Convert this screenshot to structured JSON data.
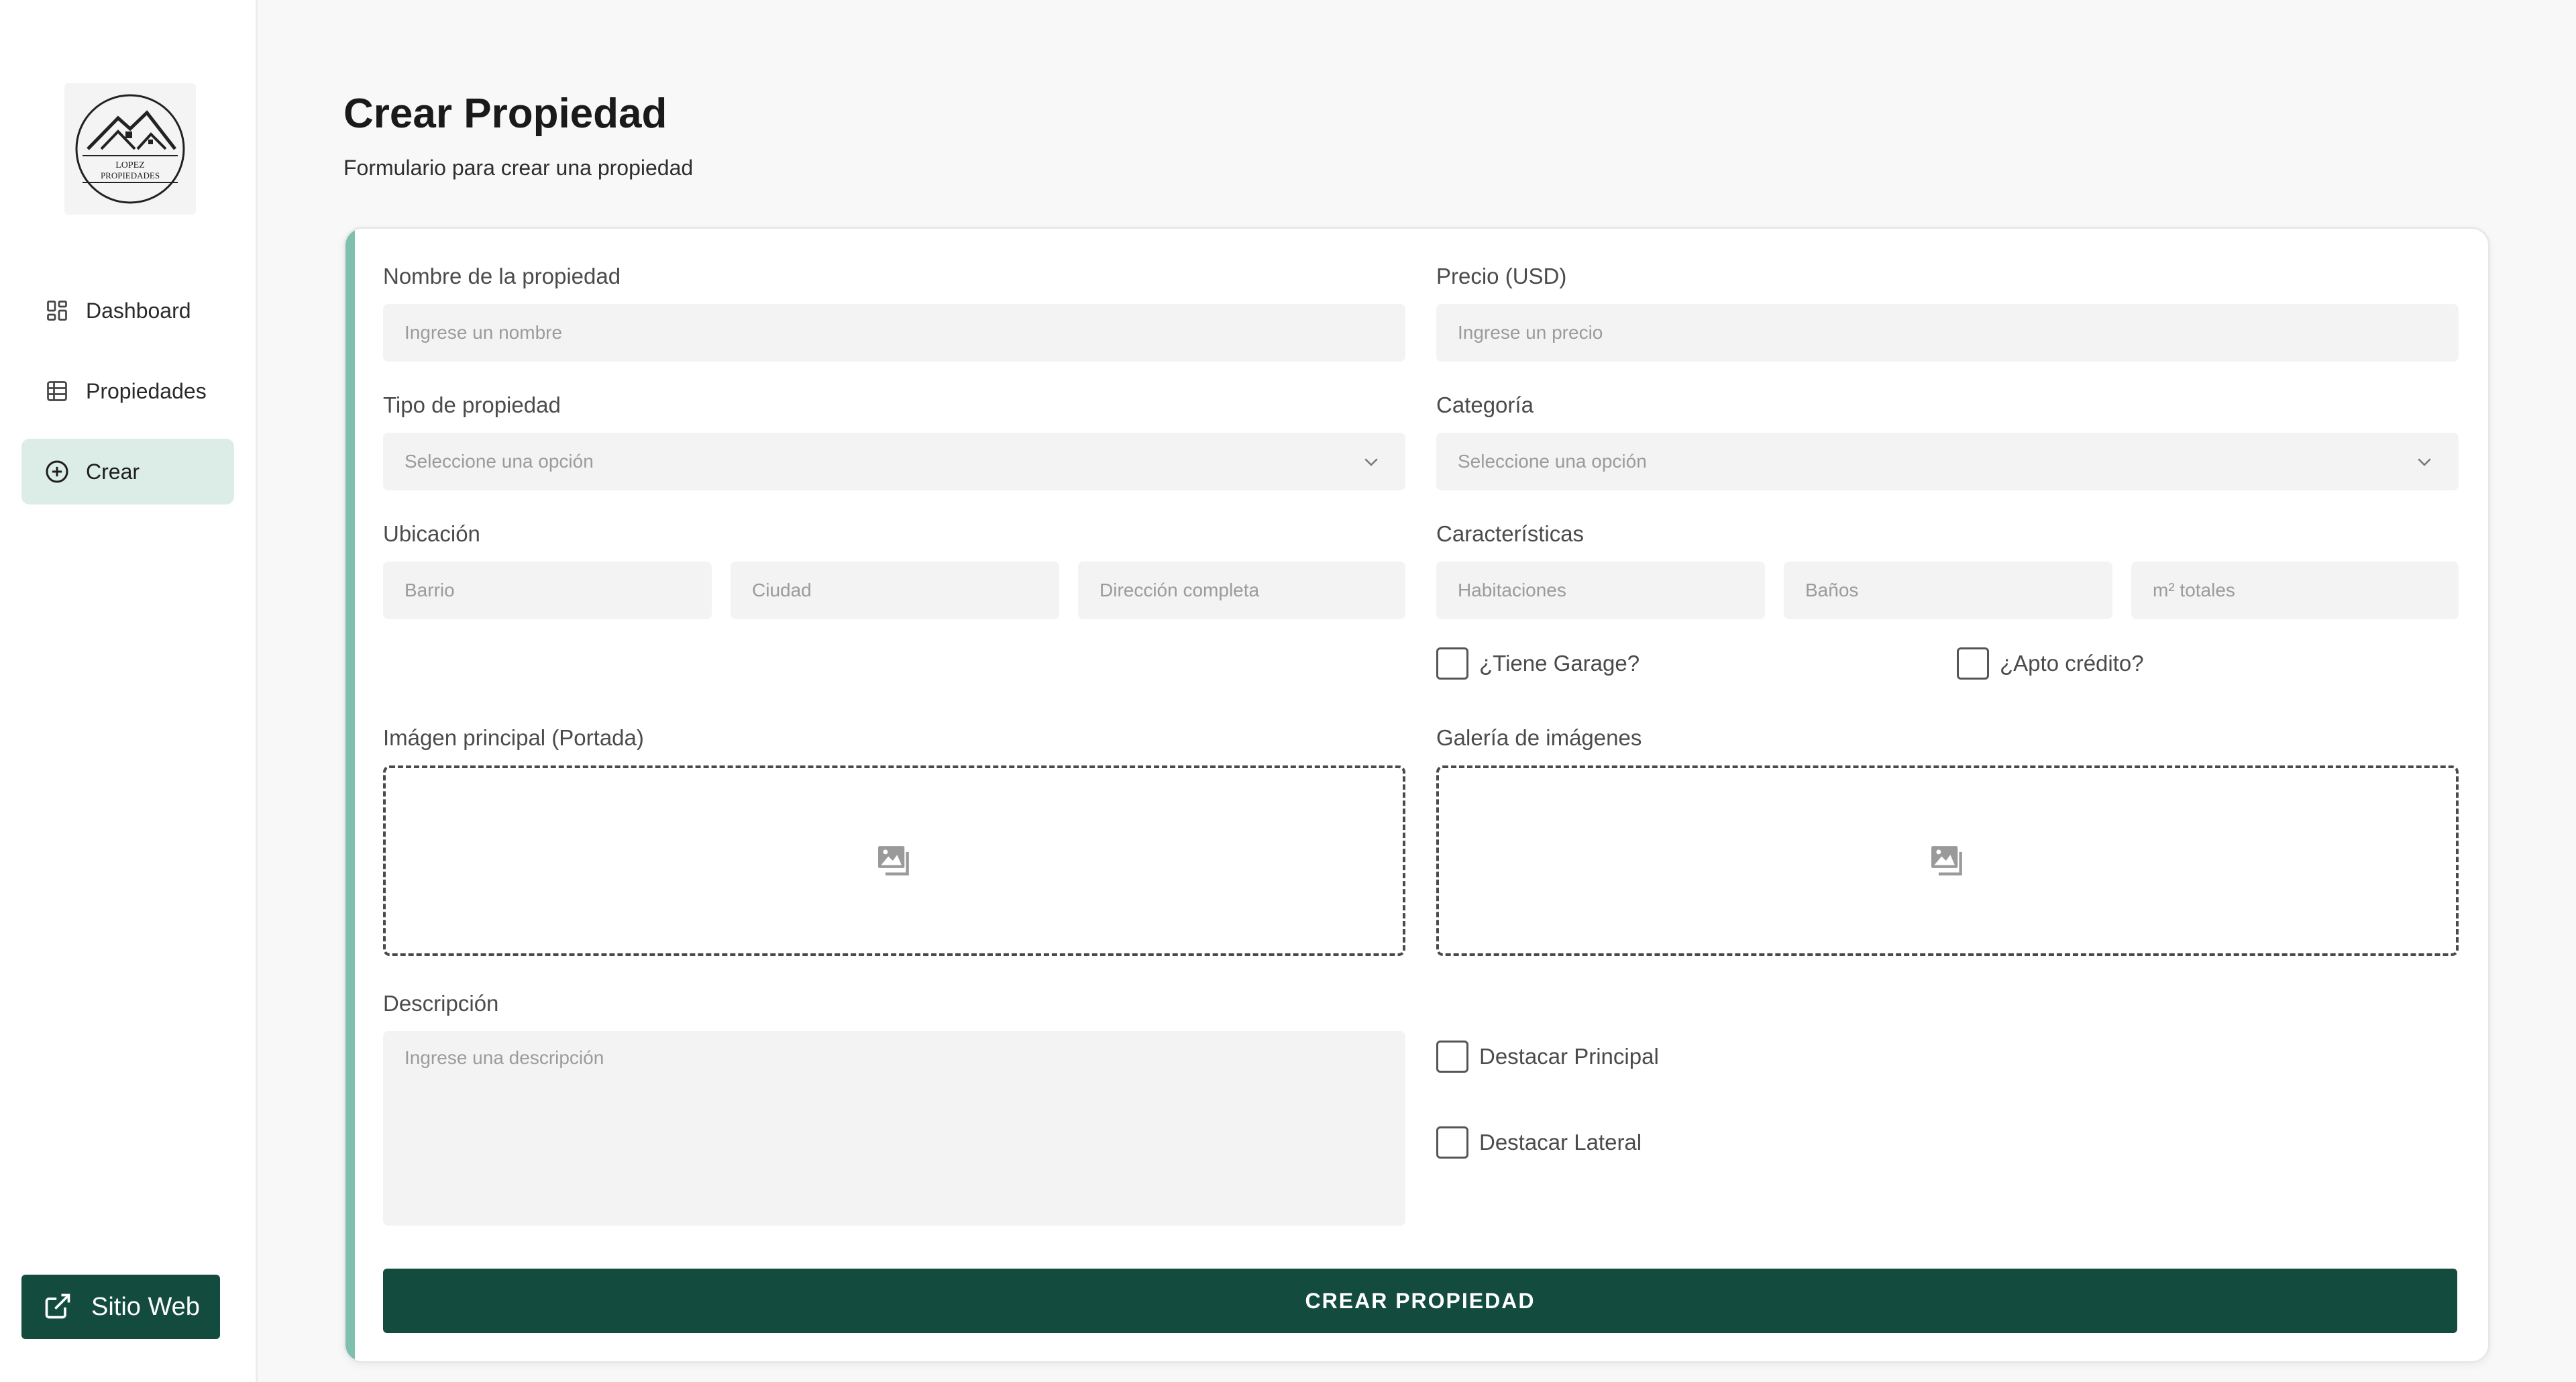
{
  "sidebar": {
    "logo_text_line1": "LOPEZ",
    "logo_text_line2": "PROPIEDADES",
    "items": [
      {
        "label": "Dashboard",
        "icon": "dashboard-grid-icon"
      },
      {
        "label": "Propiedades",
        "icon": "table-icon"
      },
      {
        "label": "Crear",
        "icon": "plus-circle-icon",
        "active": true
      }
    ],
    "website_button": "Sitio Web"
  },
  "header": {
    "title": "Crear Propiedad",
    "subtitle": "Formulario para crear una propiedad"
  },
  "form": {
    "name": {
      "label": "Nombre de la propiedad",
      "placeholder": "Ingrese un nombre"
    },
    "price": {
      "label": "Precio (USD)",
      "placeholder": "Ingrese un precio"
    },
    "type": {
      "label": "Tipo de propiedad",
      "placeholder": "Seleccione una opción"
    },
    "category": {
      "label": "Categoría",
      "placeholder": "Seleccione una opción"
    },
    "location": {
      "label": "Ubicación",
      "neighborhood": "Barrio",
      "city": "Ciudad",
      "address": "Dirección completa"
    },
    "features": {
      "label": "Características",
      "rooms": "Habitaciones",
      "baths": "Baños",
      "area": "m² totales"
    },
    "garage": "¿Tiene Garage?",
    "credit": "¿Apto crédito?",
    "main_image": {
      "label": "Imágen principal (Portada)"
    },
    "gallery": {
      "label": "Galería de imágenes"
    },
    "description": {
      "label": "Descripción",
      "placeholder": "Ingrese una descripción"
    },
    "featured_main": "Destacar Principal",
    "featured_side": "Destacar Lateral",
    "submit": "CREAR PROPIEDAD"
  },
  "colors": {
    "accent": "#134c3f",
    "active_nav_bg": "#dcede8",
    "card_border_accent": "#7fbfae"
  }
}
